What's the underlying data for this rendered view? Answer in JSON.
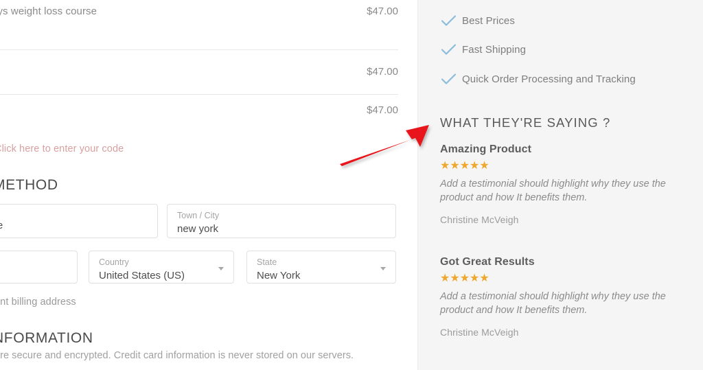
{
  "order_summary": {
    "lines": [
      {
        "label": "ays weight loss course",
        "price": "$47.00"
      },
      {
        "label": "",
        "price": "$47.00"
      },
      {
        "label": "",
        "price": "$47.00"
      }
    ],
    "coupon_link": "Click here to enter your code"
  },
  "billing": {
    "section_title": "METHOD",
    "fields": {
      "address": {
        "label": "",
        "value": "avenue"
      },
      "city": {
        "label": "Town / City",
        "value": "new york"
      },
      "postcode": {
        "label": "",
        "value": ""
      },
      "country": {
        "label": "Country",
        "value": "United States (US)"
      },
      "state": {
        "label": "State",
        "value": "New York"
      }
    },
    "different_billing_text": "ent billing address"
  },
  "payment": {
    "section_title": "NFORMATION",
    "secure_note": "are secure and encrypted. Credit card information is never stored on our servers."
  },
  "sidebar": {
    "benefits": [
      {
        "icon": "check-icon",
        "label": "Best Prices"
      },
      {
        "icon": "check-icon",
        "label": "Fast Shipping"
      },
      {
        "icon": "check-icon",
        "label": "Quick Order Processing and Tracking"
      }
    ],
    "testimonials_heading": "WHAT THEY'RE SAYING ?",
    "testimonials": [
      {
        "title": "Amazing Product",
        "stars": "★★★★★",
        "rating": 5,
        "body": "Add a testimonial should highlight why they use the product and how It benefits them.",
        "author": "Christine McVeigh"
      },
      {
        "title": "Got Great Results",
        "stars": "★★★★★",
        "rating": 5,
        "body": "Add a testimonial should highlight why they use the product and how It benefits them.",
        "author": "Christine McVeigh"
      }
    ]
  },
  "annotation": {
    "arrow_color": "#e8141a",
    "arrow_name": "red-pointer-arrow"
  },
  "colors": {
    "panel_bg": "#f5f5f5",
    "star": "#eea830",
    "check": "#8cbcdc",
    "coupon_link": "#d9a0a0",
    "arrow": "#e8141a"
  }
}
